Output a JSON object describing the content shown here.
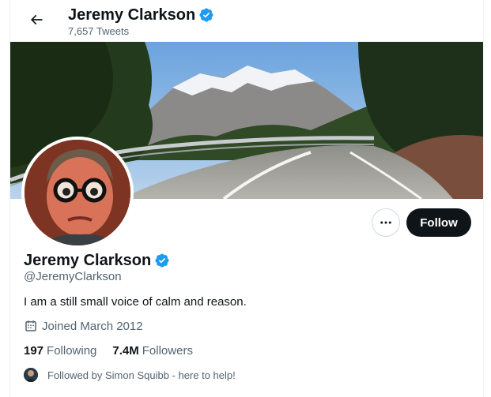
{
  "header": {
    "name": "Jeremy Clarkson",
    "tweet_count": "7,657 Tweets"
  },
  "profile": {
    "name": "Jeremy Clarkson",
    "handle": "@JeremyClarkson",
    "bio": "I am a still small voice of calm and reason.",
    "joined": "Joined March 2012",
    "following_count": "197",
    "following_label": "Following",
    "followers_count": "7.4M",
    "followers_label": "Followers",
    "followed_by": "Followed by Simon Squibb - here to help!"
  },
  "actions": {
    "follow_label": "Follow"
  },
  "icons": {
    "back": "arrow-left-icon",
    "verified": "verified-badge-icon",
    "more": "more-horizontal-icon",
    "calendar": "calendar-icon"
  },
  "colors": {
    "verified": "#1d9bf0",
    "follow_button": "#0f1419",
    "secondary_text": "#536471"
  }
}
